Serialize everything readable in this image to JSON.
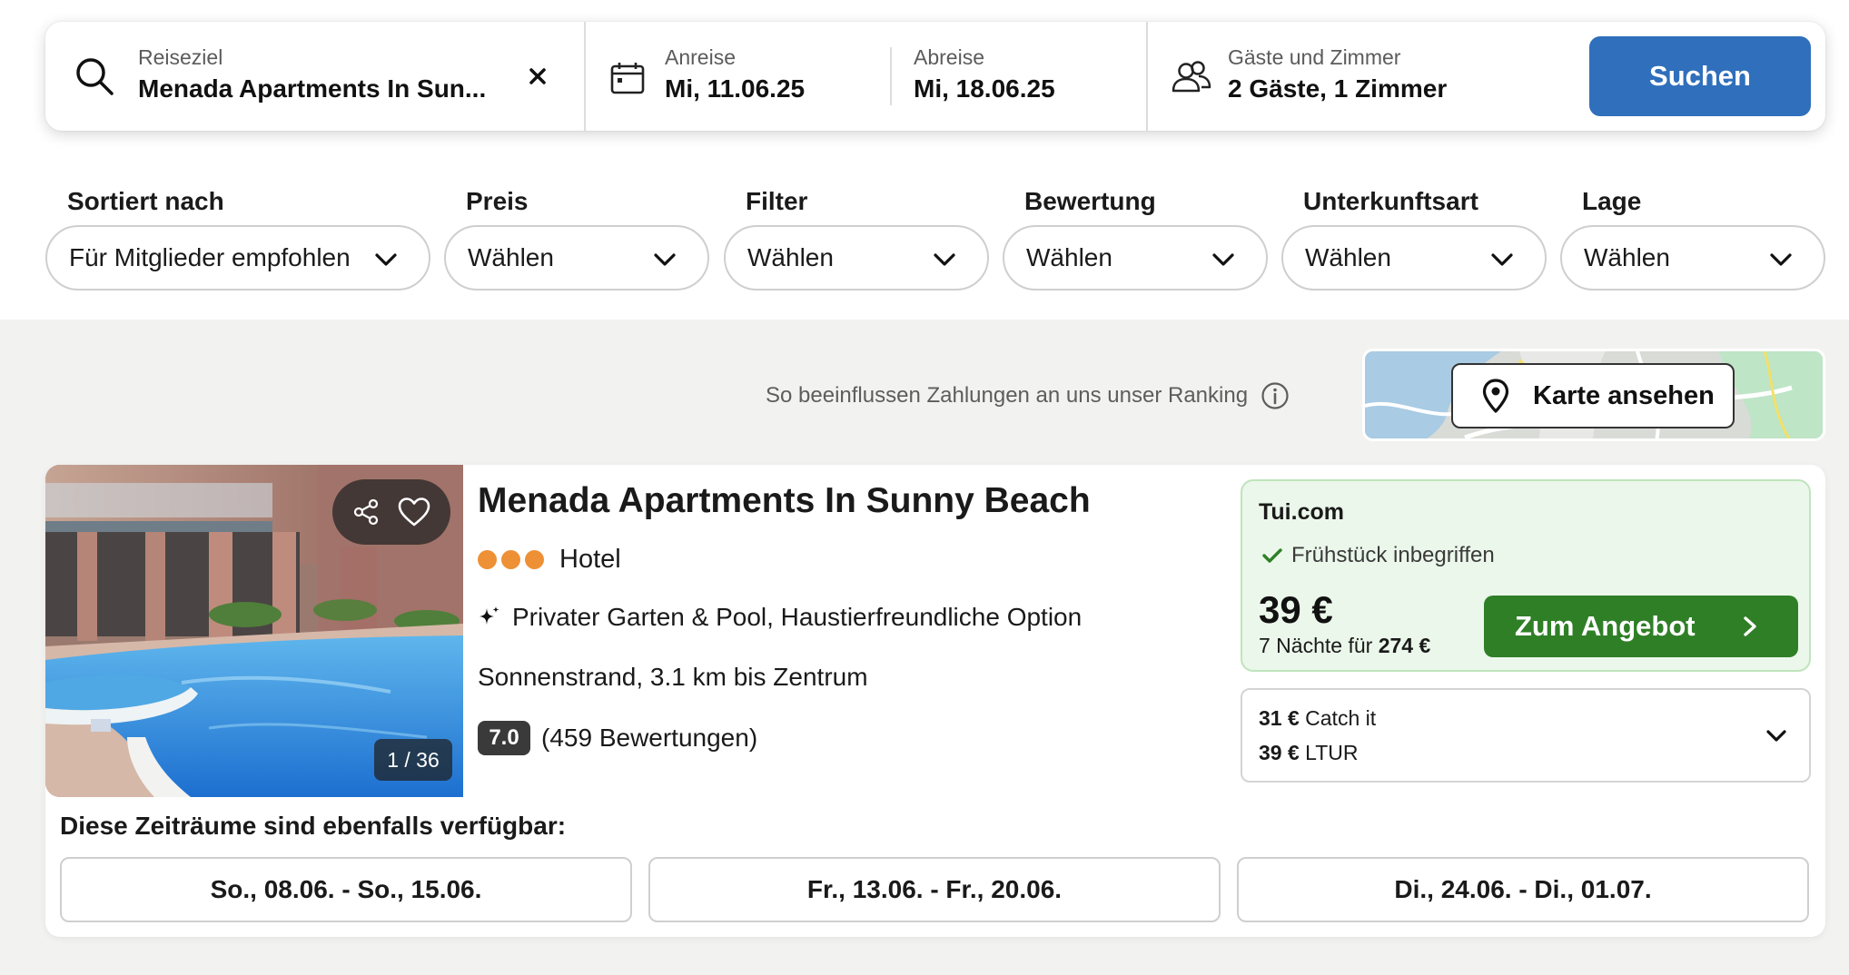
{
  "search": {
    "destination": {
      "label": "Reiseziel",
      "value": "Menada Apartments In Sun..."
    },
    "checkin": {
      "label": "Anreise",
      "value": "Mi, 11.06.25"
    },
    "checkout": {
      "label": "Abreise",
      "value": "Mi, 18.06.25"
    },
    "guests": {
      "label": "Gäste und Zimmer",
      "value": "2 Gäste, 1 Zimmer"
    },
    "button": "Suchen"
  },
  "filters": [
    {
      "label": "Sortiert nach",
      "value": "Für Mitglieder empfohlen"
    },
    {
      "label": "Preis",
      "value": "Wählen"
    },
    {
      "label": "Filter",
      "value": "Wählen"
    },
    {
      "label": "Bewertung",
      "value": "Wählen"
    },
    {
      "label": "Unterkunftsart",
      "value": "Wählen"
    },
    {
      "label": "Lage",
      "value": "Wählen"
    }
  ],
  "ranking_text": "So beeinflussen Zahlungen an uns unser Ranking",
  "map_button": "Karte ansehen",
  "hotel": {
    "name": "Menada Apartments In Sunny Beach",
    "type": "Hotel",
    "stars": 3,
    "features": "Privater Garten & Pool, Haustierfreundliche Option",
    "location": "Sonnenstrand, 3.1 km bis Zentrum",
    "rating": "7.0",
    "reviews": "(459 Bewertungen)",
    "photo_counter": "1 / 36",
    "offer": {
      "provider": "Tui.com",
      "breakfast": "Frühstück inbegriffen",
      "price": "39 €",
      "nights_prefix": "7 Nächte für",
      "nights_total": "274 €",
      "button": "Zum Angebot"
    },
    "other_offers": [
      {
        "price": "31 €",
        "provider": "Catch it"
      },
      {
        "price": "39 €",
        "provider": "LTUR"
      }
    ]
  },
  "alt_dates": {
    "title": "Diese Zeiträume sind ebenfalls verfügbar:",
    "options": [
      "So., 08.06. - So., 15.06.",
      "Fr., 13.06. - Fr., 20.06.",
      "Di., 24.06. - Di., 01.07."
    ]
  },
  "colors": {
    "primary_blue": "#2f6fbb",
    "cta_green": "#2f7f27",
    "offer_bg": "#ebf7ea",
    "star_orange": "#ee9035",
    "page_bg": "#f2f2f1"
  },
  "icons": [
    "search-icon",
    "close-icon",
    "calendar-icon",
    "guests-icon",
    "chevron-down-icon",
    "info-icon",
    "map-pin-icon",
    "share-icon",
    "heart-icon",
    "sparkle-icon",
    "check-icon",
    "chevron-right-icon"
  ]
}
